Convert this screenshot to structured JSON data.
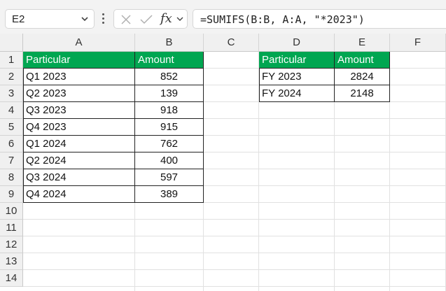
{
  "formula_bar": {
    "name_box": "E2",
    "formula": "=SUMIFS(B:B, A:A, \"*2023\")",
    "fx_label": "fx"
  },
  "columns": [
    "A",
    "B",
    "C",
    "D",
    "E",
    "F"
  ],
  "rows": [
    "1",
    "2",
    "3",
    "4",
    "5",
    "6",
    "7",
    "8",
    "9",
    "10",
    "11",
    "12",
    "13",
    "14"
  ],
  "table1": {
    "headers": [
      "Particular",
      "Amount"
    ],
    "rows": [
      [
        "Q1 2023",
        "852"
      ],
      [
        "Q2 2023",
        "139"
      ],
      [
        "Q3 2023",
        "918"
      ],
      [
        "Q4 2023",
        "915"
      ],
      [
        "Q1 2024",
        "762"
      ],
      [
        "Q2 2024",
        "400"
      ],
      [
        "Q3 2024",
        "597"
      ],
      [
        "Q4 2024",
        "389"
      ]
    ]
  },
  "table2": {
    "headers": [
      "Particular",
      "Amount"
    ],
    "rows": [
      [
        "FY 2023",
        "2824"
      ],
      [
        "FY 2024",
        "2148"
      ]
    ]
  },
  "colors": {
    "header_fill": "#00a651",
    "header_text": "#ffffff"
  }
}
